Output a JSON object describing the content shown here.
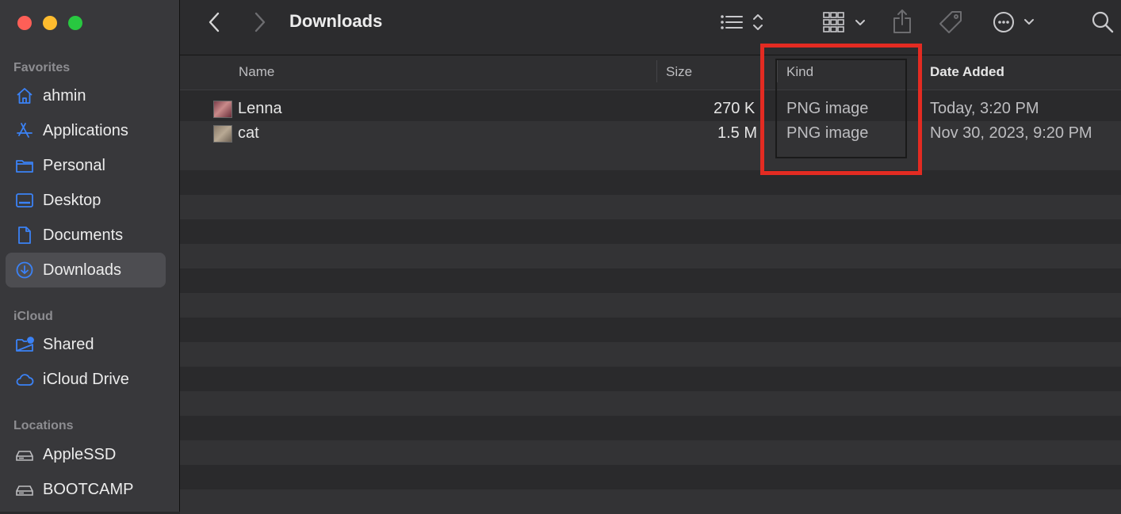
{
  "window": {
    "title": "Downloads"
  },
  "sidebar": {
    "sections": [
      {
        "title": "Favorites",
        "items": [
          {
            "label": "ahmin",
            "icon": "home-icon"
          },
          {
            "label": "Applications",
            "icon": "applications-icon"
          },
          {
            "label": "Personal",
            "icon": "folder-icon"
          },
          {
            "label": "Desktop",
            "icon": "desktop-icon"
          },
          {
            "label": "Documents",
            "icon": "document-icon"
          },
          {
            "label": "Downloads",
            "icon": "download-icon",
            "selected": true
          }
        ]
      },
      {
        "title": "iCloud",
        "items": [
          {
            "label": "Shared",
            "icon": "shared-folder-icon"
          },
          {
            "label": "iCloud Drive",
            "icon": "cloud-icon"
          }
        ]
      },
      {
        "title": "Locations",
        "items": [
          {
            "label": "AppleSSD",
            "icon": "drive-icon"
          },
          {
            "label": "BOOTCAMP",
            "icon": "drive-icon"
          }
        ]
      }
    ]
  },
  "toolbar": {
    "icons": [
      "back-icon",
      "forward-icon",
      "list-view-icon",
      "group-icon",
      "share-icon",
      "tag-icon",
      "more-icon",
      "search-icon"
    ]
  },
  "columns": {
    "name": "Name",
    "size": "Size",
    "kind": "Kind",
    "date_added": "Date Added"
  },
  "files": [
    {
      "name": "Lenna",
      "size": "270 K",
      "kind": "PNG image",
      "date_added": "Today, 3:20 PM"
    },
    {
      "name": "cat",
      "size": "1.5 M",
      "kind": "PNG image",
      "date_added": "Nov 30, 2023, 9:20 PM"
    }
  ],
  "colors": {
    "accent": "#3b82f6",
    "highlight": "#e32b22",
    "selected_bg": "#4d4d51"
  }
}
